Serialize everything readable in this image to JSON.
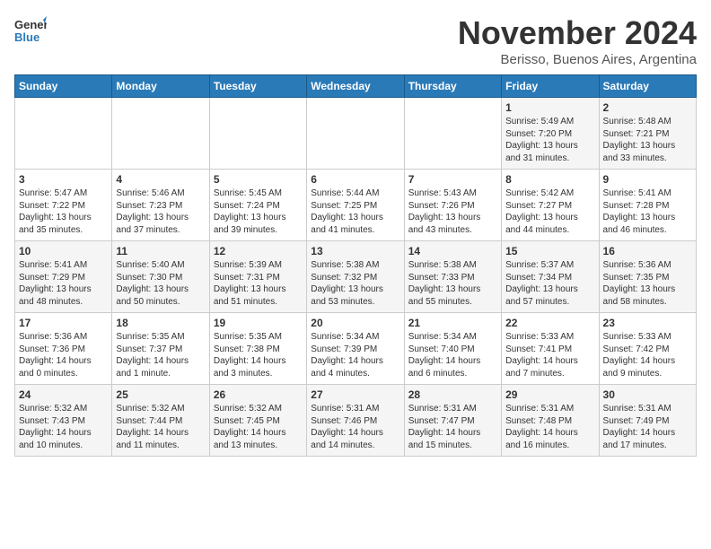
{
  "header": {
    "logo_general": "General",
    "logo_blue": "Blue",
    "month_title": "November 2024",
    "location": "Berisso, Buenos Aires, Argentina"
  },
  "days_of_week": [
    "Sunday",
    "Monday",
    "Tuesday",
    "Wednesday",
    "Thursday",
    "Friday",
    "Saturday"
  ],
  "weeks": [
    [
      {
        "day": "",
        "info": ""
      },
      {
        "day": "",
        "info": ""
      },
      {
        "day": "",
        "info": ""
      },
      {
        "day": "",
        "info": ""
      },
      {
        "day": "",
        "info": ""
      },
      {
        "day": "1",
        "info": "Sunrise: 5:49 AM\nSunset: 7:20 PM\nDaylight: 13 hours and 31 minutes."
      },
      {
        "day": "2",
        "info": "Sunrise: 5:48 AM\nSunset: 7:21 PM\nDaylight: 13 hours and 33 minutes."
      }
    ],
    [
      {
        "day": "3",
        "info": "Sunrise: 5:47 AM\nSunset: 7:22 PM\nDaylight: 13 hours and 35 minutes."
      },
      {
        "day": "4",
        "info": "Sunrise: 5:46 AM\nSunset: 7:23 PM\nDaylight: 13 hours and 37 minutes."
      },
      {
        "day": "5",
        "info": "Sunrise: 5:45 AM\nSunset: 7:24 PM\nDaylight: 13 hours and 39 minutes."
      },
      {
        "day": "6",
        "info": "Sunrise: 5:44 AM\nSunset: 7:25 PM\nDaylight: 13 hours and 41 minutes."
      },
      {
        "day": "7",
        "info": "Sunrise: 5:43 AM\nSunset: 7:26 PM\nDaylight: 13 hours and 43 minutes."
      },
      {
        "day": "8",
        "info": "Sunrise: 5:42 AM\nSunset: 7:27 PM\nDaylight: 13 hours and 44 minutes."
      },
      {
        "day": "9",
        "info": "Sunrise: 5:41 AM\nSunset: 7:28 PM\nDaylight: 13 hours and 46 minutes."
      }
    ],
    [
      {
        "day": "10",
        "info": "Sunrise: 5:41 AM\nSunset: 7:29 PM\nDaylight: 13 hours and 48 minutes."
      },
      {
        "day": "11",
        "info": "Sunrise: 5:40 AM\nSunset: 7:30 PM\nDaylight: 13 hours and 50 minutes."
      },
      {
        "day": "12",
        "info": "Sunrise: 5:39 AM\nSunset: 7:31 PM\nDaylight: 13 hours and 51 minutes."
      },
      {
        "day": "13",
        "info": "Sunrise: 5:38 AM\nSunset: 7:32 PM\nDaylight: 13 hours and 53 minutes."
      },
      {
        "day": "14",
        "info": "Sunrise: 5:38 AM\nSunset: 7:33 PM\nDaylight: 13 hours and 55 minutes."
      },
      {
        "day": "15",
        "info": "Sunrise: 5:37 AM\nSunset: 7:34 PM\nDaylight: 13 hours and 57 minutes."
      },
      {
        "day": "16",
        "info": "Sunrise: 5:36 AM\nSunset: 7:35 PM\nDaylight: 13 hours and 58 minutes."
      }
    ],
    [
      {
        "day": "17",
        "info": "Sunrise: 5:36 AM\nSunset: 7:36 PM\nDaylight: 14 hours and 0 minutes."
      },
      {
        "day": "18",
        "info": "Sunrise: 5:35 AM\nSunset: 7:37 PM\nDaylight: 14 hours and 1 minute."
      },
      {
        "day": "19",
        "info": "Sunrise: 5:35 AM\nSunset: 7:38 PM\nDaylight: 14 hours and 3 minutes."
      },
      {
        "day": "20",
        "info": "Sunrise: 5:34 AM\nSunset: 7:39 PM\nDaylight: 14 hours and 4 minutes."
      },
      {
        "day": "21",
        "info": "Sunrise: 5:34 AM\nSunset: 7:40 PM\nDaylight: 14 hours and 6 minutes."
      },
      {
        "day": "22",
        "info": "Sunrise: 5:33 AM\nSunset: 7:41 PM\nDaylight: 14 hours and 7 minutes."
      },
      {
        "day": "23",
        "info": "Sunrise: 5:33 AM\nSunset: 7:42 PM\nDaylight: 14 hours and 9 minutes."
      }
    ],
    [
      {
        "day": "24",
        "info": "Sunrise: 5:32 AM\nSunset: 7:43 PM\nDaylight: 14 hours and 10 minutes."
      },
      {
        "day": "25",
        "info": "Sunrise: 5:32 AM\nSunset: 7:44 PM\nDaylight: 14 hours and 11 minutes."
      },
      {
        "day": "26",
        "info": "Sunrise: 5:32 AM\nSunset: 7:45 PM\nDaylight: 14 hours and 13 minutes."
      },
      {
        "day": "27",
        "info": "Sunrise: 5:31 AM\nSunset: 7:46 PM\nDaylight: 14 hours and 14 minutes."
      },
      {
        "day": "28",
        "info": "Sunrise: 5:31 AM\nSunset: 7:47 PM\nDaylight: 14 hours and 15 minutes."
      },
      {
        "day": "29",
        "info": "Sunrise: 5:31 AM\nSunset: 7:48 PM\nDaylight: 14 hours and 16 minutes."
      },
      {
        "day": "30",
        "info": "Sunrise: 5:31 AM\nSunset: 7:49 PM\nDaylight: 14 hours and 17 minutes."
      }
    ]
  ]
}
